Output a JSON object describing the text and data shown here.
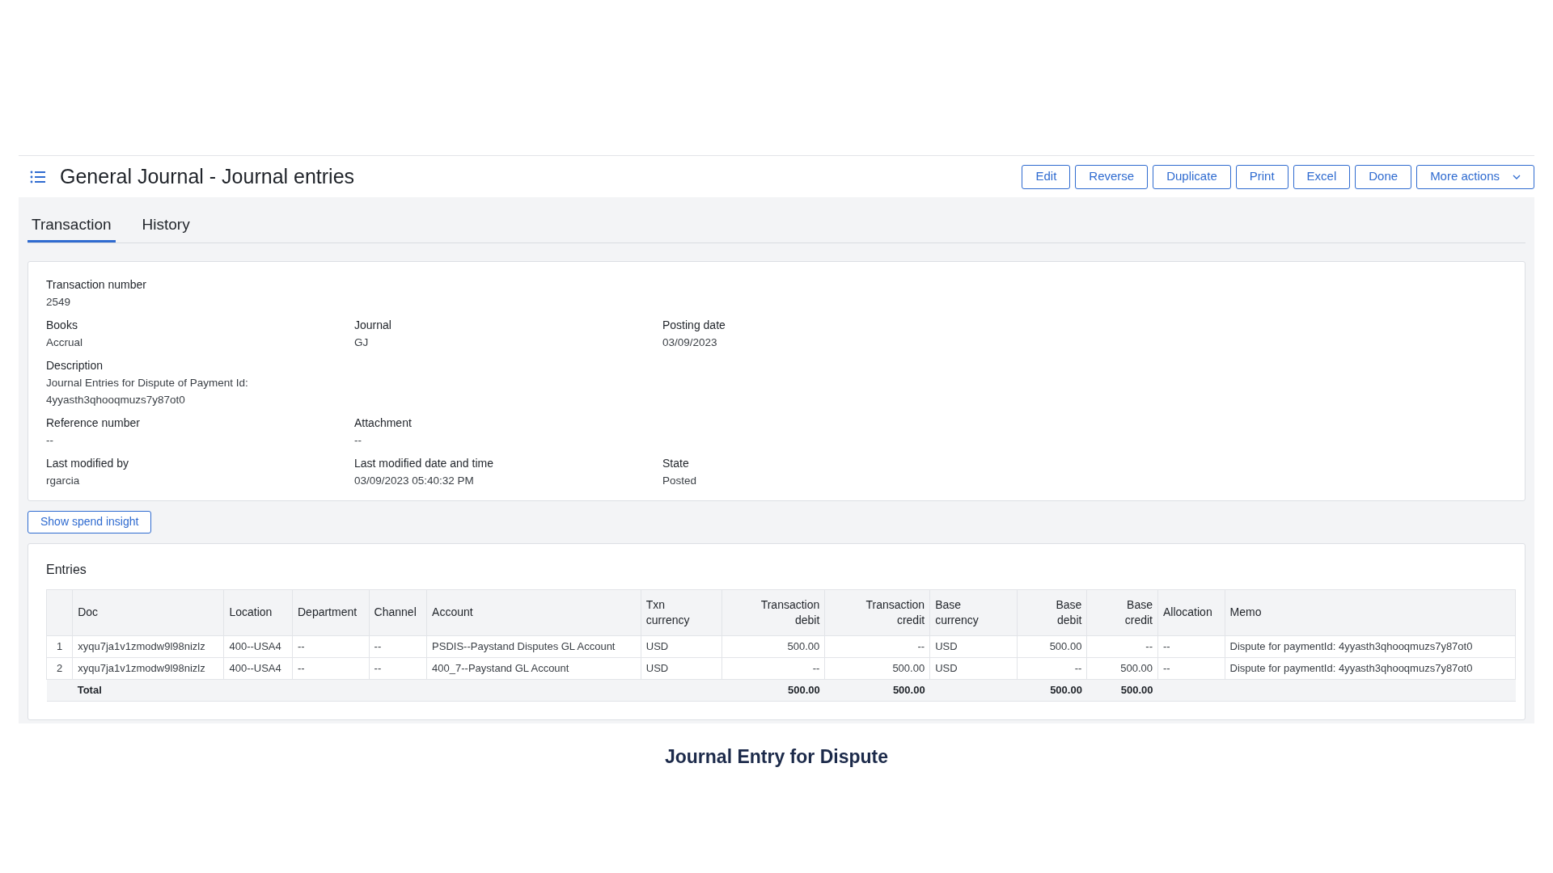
{
  "header": {
    "title": "General Journal - Journal entries"
  },
  "actions": [
    {
      "label": "Edit",
      "kind": "button"
    },
    {
      "label": "Reverse",
      "kind": "button"
    },
    {
      "label": "Duplicate",
      "kind": "button"
    },
    {
      "label": "Print",
      "kind": "button"
    },
    {
      "label": "Excel",
      "kind": "button"
    },
    {
      "label": "Done",
      "kind": "button"
    },
    {
      "label": "More actions",
      "kind": "dropdown"
    }
  ],
  "tabs": [
    {
      "label": "Transaction",
      "selected": true
    },
    {
      "label": "History",
      "selected": false
    }
  ],
  "details": [
    [
      {
        "label": "Transaction number",
        "value": "2549"
      }
    ],
    [
      {
        "label": "Books",
        "value": "Accrual"
      },
      {
        "label": "Journal",
        "value": "GJ"
      },
      {
        "label": "Posting date",
        "value": "03/09/2023"
      }
    ],
    [
      {
        "label": "Description",
        "value": "Journal Entries for Dispute of Payment Id: 4yyasth3qhooqmuzs7y87ot0"
      }
    ],
    [
      {
        "label": "Reference number",
        "value": "--"
      },
      {
        "label": "Attachment",
        "value": "--"
      }
    ],
    [
      {
        "label": "Last modified by",
        "value": "rgarcia"
      },
      {
        "label": "Last modified date and time",
        "value": "03/09/2023 05:40:32 PM"
      },
      {
        "label": "State",
        "value": "Posted"
      }
    ]
  ],
  "spend_insight_button": "Show spend insight",
  "entries": {
    "title": "Entries",
    "columns": [
      {
        "label": "Doc",
        "kind": "text"
      },
      {
        "label": "Location",
        "kind": "text"
      },
      {
        "label": "Department",
        "kind": "text"
      },
      {
        "label": "Channel",
        "kind": "text"
      },
      {
        "label": "Account",
        "kind": "text"
      },
      {
        "label": "Txn currency",
        "kind": "text"
      },
      {
        "label": "Transaction debit",
        "kind": "amount"
      },
      {
        "label": "Transaction credit",
        "kind": "amount"
      },
      {
        "label": "Base currency",
        "kind": "text"
      },
      {
        "label": "Base debit",
        "kind": "amount"
      },
      {
        "label": "Base credit",
        "kind": "amount"
      },
      {
        "label": "Allocation",
        "kind": "text"
      },
      {
        "label": "Memo",
        "kind": "text"
      }
    ],
    "rows": [
      {
        "number": "1",
        "cells": [
          "xyqu7ja1v1zmodw9l98nizlz",
          "400--USA4",
          "--",
          "--",
          "PSDIS--Paystand Disputes GL Account",
          "USD",
          "500.00",
          "--",
          "USD",
          "500.00",
          "--",
          "--",
          "Dispute for paymentId: 4yyasth3qhooqmuzs7y87ot0"
        ]
      },
      {
        "number": "2",
        "cells": [
          "xyqu7ja1v1zmodw9l98nizlz",
          "400--USA4",
          "--",
          "--",
          "400_7--Paystand GL Account",
          "USD",
          "--",
          "500.00",
          "USD",
          "--",
          "500.00",
          "--",
          "Dispute for paymentId: 4yyasth3qhooqmuzs7y87ot0"
        ]
      }
    ],
    "total": {
      "label": "Total",
      "transaction_debit": "500.00",
      "transaction_credit": "500.00",
      "base_debit": "500.00",
      "base_credit": "500.00"
    }
  },
  "caption": "Journal Entry for Dispute"
}
